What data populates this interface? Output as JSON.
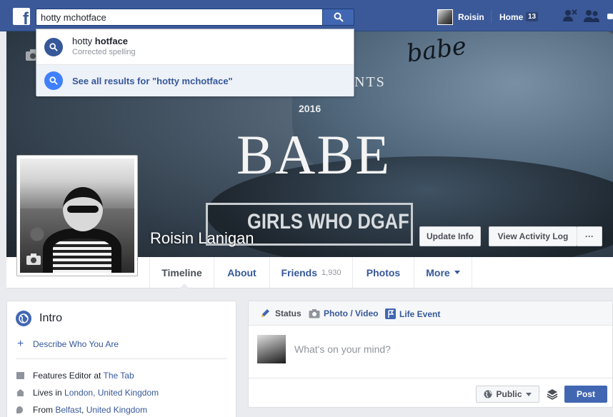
{
  "topbar": {
    "logo": "f",
    "search_value": "hotty mchotface",
    "user_name": "Roisin",
    "home_label": "Home",
    "home_count": "13"
  },
  "search_dropdown": {
    "suggestion_prefix": "hotty ",
    "suggestion_bold": "hotface",
    "suggestion_sub": "Corrected spelling",
    "see_all": "See all results for \"hotty mchotface\""
  },
  "cover": {
    "text_nts": "NTS",
    "text_year": "2016",
    "text_babe": "BABE",
    "text_dgaf": "GIRLS WHO DGAF",
    "cap_text": "babe",
    "profile_name": "Roisin Lanigan",
    "update_info": "Update Info",
    "view_activity": "View Activity Log",
    "more_dots": "···"
  },
  "tabs": {
    "timeline": "Timeline",
    "about": "About",
    "friends": "Friends",
    "friends_count": "1,930",
    "photos": "Photos",
    "more": "More"
  },
  "intro": {
    "title": "Intro",
    "describe": "Describe Who You Are",
    "job_prefix": "Features Editor at ",
    "job_link": "The Tab",
    "lives_prefix": "Lives in ",
    "lives_link": "London, United Kingdom",
    "from_prefix": "From ",
    "from_link1": "Belfast",
    "from_sep": ", ",
    "from_link2": "United Kingdom"
  },
  "composer": {
    "status": "Status",
    "photo_video": "Photo / Video",
    "life_event": "Life Event",
    "placeholder": "What's on your mind?",
    "audience": "Public",
    "post": "Post"
  },
  "colors": {
    "brand": "#3b5998",
    "link": "#365899",
    "button_blue": "#4267b2"
  }
}
